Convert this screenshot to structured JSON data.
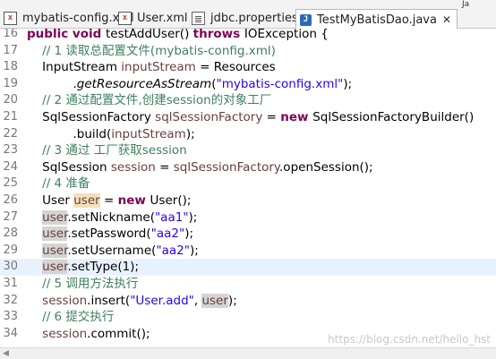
{
  "tabs": [
    {
      "label": "mybatis-config.xml",
      "icon": "xml-file-icon"
    },
    {
      "label": "User.xml",
      "icon": "xml-file-icon"
    },
    {
      "label": "jdbc.properties",
      "icon": "properties-file-icon"
    },
    {
      "label": "TestMyBatisDao.java",
      "icon": "java-file-icon",
      "active": true,
      "close": "✕"
    }
  ],
  "top_right_label": "Ja",
  "lines": [
    {
      "n": "16",
      "segments": [
        [
          "kw",
          "public void "
        ],
        [
          "plain",
          "testAddUser() "
        ],
        [
          "kw",
          "throws "
        ],
        [
          "plain",
          "IOException {"
        ]
      ]
    },
    {
      "n": "17",
      "segments": [
        [
          "cm",
          "    // 1 读取总配置文件(mybatis-config.xml)"
        ]
      ]
    },
    {
      "n": "18",
      "segments": [
        [
          "plain",
          "    InputStream "
        ],
        [
          "fd",
          "inputStream"
        ],
        [
          "plain",
          " = Resources"
        ]
      ]
    },
    {
      "n": "19",
      "segments": [
        [
          "plain",
          "            ."
        ],
        [
          "it",
          "getResourceAsStream"
        ],
        [
          "plain",
          "("
        ],
        [
          "st",
          "\"mybatis-config.xml\""
        ],
        [
          "plain",
          ");"
        ]
      ]
    },
    {
      "n": "20",
      "segments": [
        [
          "cm",
          "    // 2 通过配置文件,创建session的对象工厂"
        ]
      ]
    },
    {
      "n": "21",
      "segments": [
        [
          "plain",
          "    SqlSessionFactory "
        ],
        [
          "fd",
          "sqlSessionFactory"
        ],
        [
          "plain",
          " = "
        ],
        [
          "kw",
          "new "
        ],
        [
          "plain",
          "SqlSessionFactoryBuilder()"
        ]
      ]
    },
    {
      "n": "22",
      "segments": [
        [
          "plain",
          "            .build("
        ],
        [
          "fd",
          "inputStream"
        ],
        [
          "plain",
          ");"
        ]
      ]
    },
    {
      "n": "23",
      "segments": [
        [
          "cm",
          "    // 3 通过 工厂获取session"
        ]
      ]
    },
    {
      "n": "24",
      "segments": [
        [
          "plain",
          "    SqlSession "
        ],
        [
          "fd",
          "session"
        ],
        [
          "plain",
          " = "
        ],
        [
          "fd",
          "sqlSessionFactory"
        ],
        [
          "plain",
          ".openSession();"
        ]
      ]
    },
    {
      "n": "25",
      "segments": [
        [
          "cm",
          "    // 4 准备"
        ]
      ]
    },
    {
      "n": "26",
      "segments": [
        [
          "plain",
          "    User "
        ],
        [
          "fdhl2",
          "user"
        ],
        [
          "plain",
          " = "
        ],
        [
          "kw",
          "new "
        ],
        [
          "plain",
          "User();"
        ]
      ]
    },
    {
      "n": "27",
      "segments": [
        [
          "plain",
          "    "
        ],
        [
          "fdhl",
          "user"
        ],
        [
          "plain",
          ".setNickname("
        ],
        [
          "st",
          "\"aa1\""
        ],
        [
          "plain",
          ");"
        ]
      ]
    },
    {
      "n": "28",
      "segments": [
        [
          "plain",
          "    "
        ],
        [
          "fdhl",
          "user"
        ],
        [
          "plain",
          ".setPassword("
        ],
        [
          "st",
          "\"aa2\""
        ],
        [
          "plain",
          ");"
        ]
      ]
    },
    {
      "n": "29",
      "segments": [
        [
          "plain",
          "    "
        ],
        [
          "fdhl",
          "user"
        ],
        [
          "plain",
          ".setUsername("
        ],
        [
          "st",
          "\"aa2\""
        ],
        [
          "plain",
          ");"
        ]
      ]
    },
    {
      "n": "30",
      "current": true,
      "segments": [
        [
          "plain",
          "    "
        ],
        [
          "fdhl",
          "user"
        ],
        [
          "plain",
          ".setType(1);"
        ]
      ]
    },
    {
      "n": "31",
      "segments": [
        [
          "cm",
          "    // 5 调用方法执行"
        ]
      ]
    },
    {
      "n": "32",
      "segments": [
        [
          "plain",
          "    "
        ],
        [
          "fd",
          "session"
        ],
        [
          "plain",
          ".insert("
        ],
        [
          "st",
          "\"User.add\""
        ],
        [
          "plain",
          ", "
        ],
        [
          "fdhl",
          "user"
        ],
        [
          "plain",
          ");"
        ]
      ]
    },
    {
      "n": "33",
      "segments": [
        [
          "cm",
          "    // 6 提交执行"
        ]
      ]
    },
    {
      "n": "34",
      "segments": [
        [
          "plain",
          "    "
        ],
        [
          "fd",
          "session"
        ],
        [
          "plain",
          ".commit();"
        ]
      ]
    }
  ],
  "watermark": "https://blog.csdn.net/hello_hst"
}
